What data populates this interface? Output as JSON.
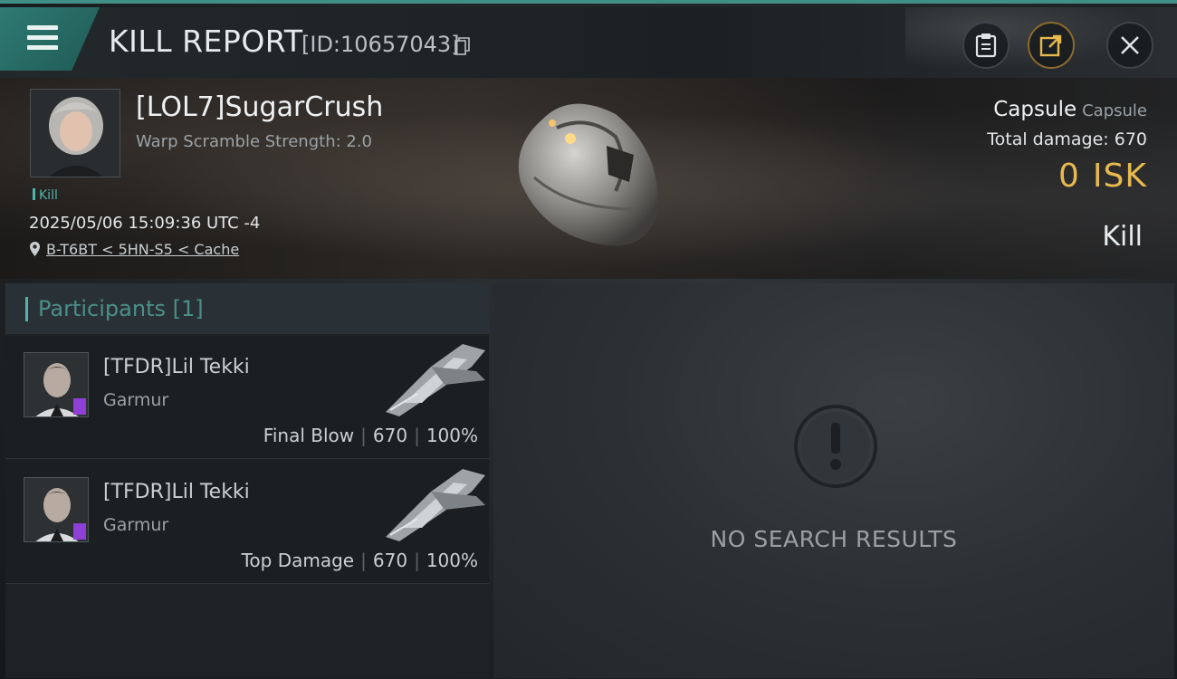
{
  "header": {
    "title": "KILL REPORT",
    "report_id": "[ID:10657043]"
  },
  "victim": {
    "name": "[LOL7]SugarCrush",
    "warp_scramble": "Warp Scramble Strength: 2.0",
    "tag": "Kill",
    "timestamp": "2025/05/06 15:09:36 UTC -4",
    "location": "B-T6BT < 5HN-S5 < Cache",
    "ship_name": "Capsule",
    "ship_class": "Capsule",
    "total_damage": "Total damage:  670",
    "isk_value": "0",
    "isk_unit": "ISK",
    "result": "Kill"
  },
  "participants": {
    "title": "Participants",
    "count": "[1]",
    "rows": [
      {
        "name": "[TFDR]Lil Tekki",
        "ship": "Garmur",
        "label": "Final Blow",
        "damage": "670",
        "percent": "100%"
      },
      {
        "name": "[TFDR]Lil Tekki",
        "ship": "Garmur",
        "label": "Top Damage",
        "damage": "670",
        "percent": "100%"
      }
    ]
  },
  "detail": {
    "empty_text": "NO SEARCH RESULTS"
  },
  "colors": {
    "accent": "#4fb5a8",
    "isk": "#e7b94f",
    "badge": "#8d3fd6"
  }
}
